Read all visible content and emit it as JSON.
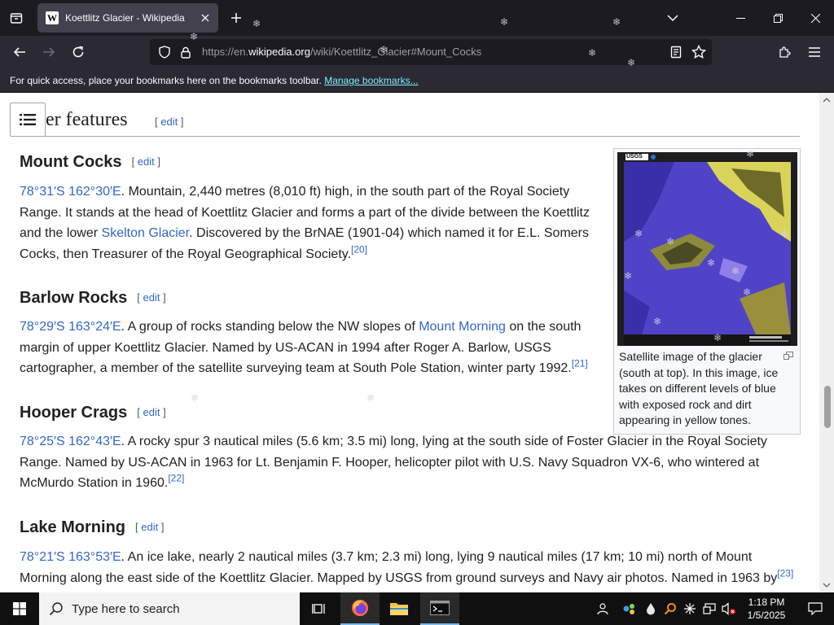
{
  "browser": {
    "tab_title": "Koettlitz Glacier - Wikipedia",
    "favicon_letter": "W",
    "url_prefix": "https://en.",
    "url_host": "wikipedia.org",
    "url_path": "/wiki/Koettlitz_Glacier#Mount_Cocks",
    "bookmarks_message": "For quick access, place your bookmarks here on the bookmarks toolbar.",
    "bookmarks_link": "Manage bookmarks..."
  },
  "article": {
    "section_heading_visible": "her features",
    "edit_label": "edit",
    "subsections": [
      {
        "title": "Mount Cocks",
        "coords": "78°31′S 162°30′E",
        "text_a": ". Mountain, 2,440 metres (8,010 ft) high, in the south part of the Royal Society Range. It stands at the head of Koettlitz Glacier and forms a part of the divide between the Koettlitz and the lower ",
        "link": "Skelton Glacier",
        "text_b": ". Discovered by the BrNAE (1901-04) which named it for E.L. Somers Cocks, then Treasurer of the Royal Geographical Society.",
        "ref": "[20]"
      },
      {
        "title": "Barlow Rocks",
        "coords": "78°29′S 163°24′E",
        "text_a": ". A group of rocks standing below the NW slopes of ",
        "link": "Mount Morning",
        "text_b": " on the south margin of upper Koettlitz Glacier. Named by US-ACAN in 1994 after Roger A. Barlow, USGS cartographer, a member of the satellite surveying team at South Pole Station, winter party 1992.",
        "ref": "[21]"
      },
      {
        "title": "Hooper Crags",
        "coords": "78°25′S 162°43′E",
        "text_a": ". A rocky spur 3 nautical miles (5.6 km; 3.5 mi) long, lying at the south side of Foster Glacier in the Royal Society Range. Named by US-ACAN in 1963 for Lt. Benjamin F. Hooper, helicopter pilot with U.S. Navy Squadron VX-6, who wintered at McMurdo Station in 1960.",
        "ref": "[22]"
      },
      {
        "title": "Lake Morning",
        "coords": "78°21′S 163°53′E",
        "text_a": ". An ice lake, nearly 2 nautical miles (3.7 km; 2.3 mi) long, lying 9 nautical miles (17 km; 10 mi) north of Mount Morning along the east side of the Koettlitz Glacier. Mapped by USGS from ground surveys and Navy air photos. Named in 1963 by",
        "ref": "[23]"
      }
    ],
    "figure": {
      "caption": "Satellite image of the glacier (south at top). In this image, ice takes on different levels of blue with exposed rock and dirt appearing in yellow tones.",
      "logo_text": "USGS"
    }
  },
  "taskbar": {
    "search_placeholder": "Type here to search",
    "time": "1:18 PM",
    "date": "1/5/2025"
  },
  "colors": {
    "link": "#3366cc",
    "browser_dark": "#1c1b22",
    "toolbar": "#2b2a33",
    "bookmark_link": "#80ebff"
  }
}
